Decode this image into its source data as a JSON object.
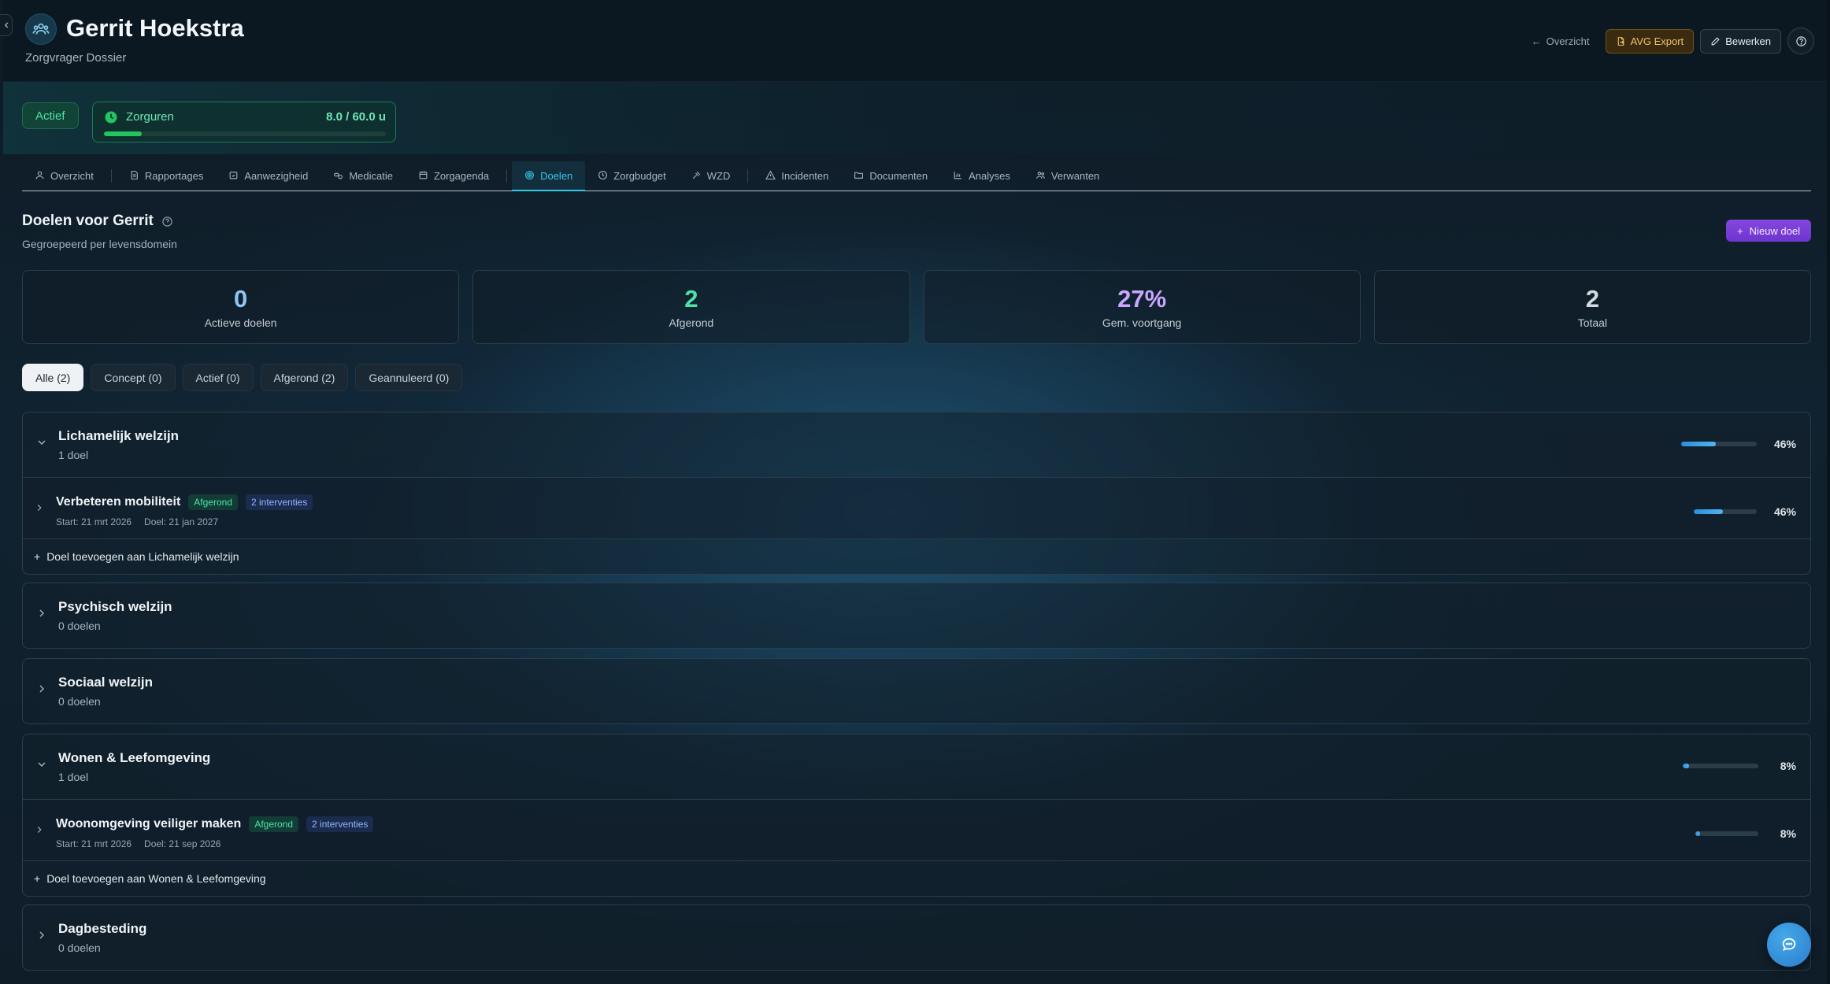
{
  "header": {
    "name": "Gerrit Hoekstra",
    "subtitle": "Zorgvrager Dossier",
    "overview_link": "Overzicht",
    "avg_export": "AVG Export",
    "edit": "Bewerken"
  },
  "status": {
    "label": "Actief",
    "hours_label": "Zorguren",
    "hours_value": "8.0 / 60.0 u",
    "hours_fraction": 0.133
  },
  "tabs": [
    {
      "label": "Overzicht",
      "icon": "person-icon"
    },
    {
      "label": "Rapportages",
      "icon": "document-icon"
    },
    {
      "label": "Aanwezigheid",
      "icon": "calendar-check-icon"
    },
    {
      "label": "Medicatie",
      "icon": "pills-icon"
    },
    {
      "label": "Zorgagenda",
      "icon": "calendar-icon"
    },
    {
      "label": "Doelen",
      "icon": "target-icon"
    },
    {
      "label": "Zorgbudget",
      "icon": "clock-icon"
    },
    {
      "label": "WZD",
      "icon": "gavel-icon"
    },
    {
      "label": "Incidenten",
      "icon": "warning-icon"
    },
    {
      "label": "Documenten",
      "icon": "folder-icon"
    },
    {
      "label": "Analyses",
      "icon": "chart-icon"
    },
    {
      "label": "Verwanten",
      "icon": "people-icon"
    }
  ],
  "section": {
    "title": "Doelen voor Gerrit",
    "subtitle": "Gegroepeerd per levensdomein",
    "new_button": "Nieuw doel"
  },
  "stats": [
    {
      "value": "0",
      "label": "Actieve doelen",
      "color": "#8ec5f5"
    },
    {
      "value": "2",
      "label": "Afgerond",
      "color": "#4ee2a8"
    },
    {
      "value": "27%",
      "label": "Gem. voortgang",
      "color": "#c9a7ff"
    },
    {
      "value": "2",
      "label": "Totaal",
      "color": "#d4dbe0"
    }
  ],
  "filters": [
    {
      "label": "Alle (2)"
    },
    {
      "label": "Concept (0)"
    },
    {
      "label": "Actief (0)"
    },
    {
      "label": "Afgerond (2)"
    },
    {
      "label": "Geannuleerd (0)"
    }
  ],
  "domains": [
    {
      "name": "Lichamelijk welzijn",
      "count": "1 doel",
      "progress_pct": "46%",
      "progress": 0.46,
      "goal": {
        "title": "Verbeteren mobiliteit",
        "status": "Afgerond",
        "interventions": "2 interventies",
        "start": "Start: 21 mrt 2026",
        "target": "Doel: 21 jan 2027",
        "progress_pct": "46%",
        "progress": 0.46
      },
      "add_label": "Doel toevoegen aan Lichamelijk welzijn"
    },
    {
      "name": "Psychisch welzijn",
      "count": "0 doelen"
    },
    {
      "name": "Sociaal welzijn",
      "count": "0 doelen"
    },
    {
      "name": "Wonen & Leefomgeving",
      "count": "1 doel",
      "progress_pct": "8%",
      "progress": 0.08,
      "goal": {
        "title": "Woonomgeving veiliger maken",
        "status": "Afgerond",
        "interventions": "2 interventies",
        "start": "Start: 21 mrt 2026",
        "target": "Doel: 21 sep 2026",
        "progress_pct": "8%",
        "progress": 0.08
      },
      "add_label": "Doel toevoegen aan Wonen & Leefomgeving"
    },
    {
      "name": "Dagbesteding",
      "count": "0 doelen"
    }
  ]
}
